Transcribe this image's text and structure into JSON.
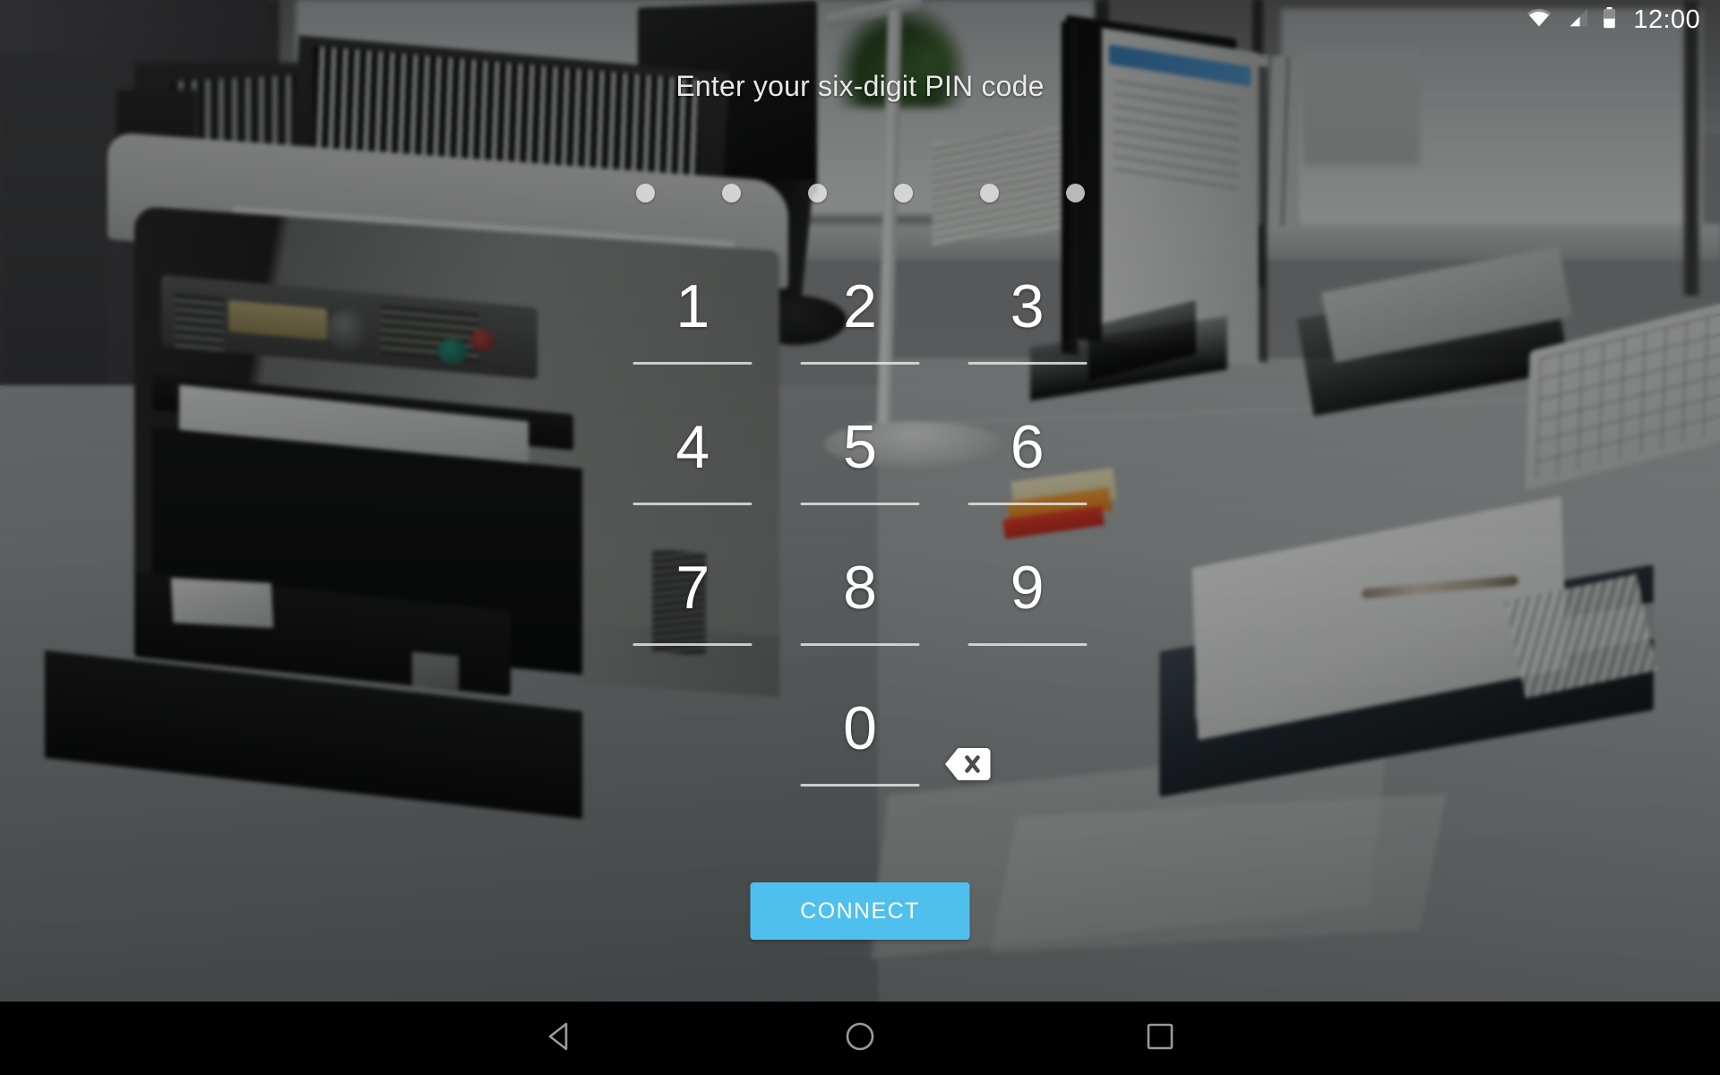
{
  "status_bar": {
    "wifi_icon": "wifi-icon",
    "signal_icon": "cellular-signal-icon",
    "battery_icon": "battery-icon",
    "time": "12:00"
  },
  "pin_screen": {
    "title": "Enter your six-digit PIN code",
    "pin_length": 6,
    "entered_digits": 6,
    "dots": [
      "•",
      "•",
      "•",
      "•",
      "•",
      "•"
    ],
    "keypad": [
      {
        "label": "1",
        "name": "key-1"
      },
      {
        "label": "2",
        "name": "key-2"
      },
      {
        "label": "3",
        "name": "key-3"
      },
      {
        "label": "4",
        "name": "key-4"
      },
      {
        "label": "5",
        "name": "key-5"
      },
      {
        "label": "6",
        "name": "key-6"
      },
      {
        "label": "7",
        "name": "key-7"
      },
      {
        "label": "8",
        "name": "key-8"
      },
      {
        "label": "9",
        "name": "key-9"
      },
      {
        "label": "",
        "name": "key-blank-left"
      },
      {
        "label": "0",
        "name": "key-0"
      },
      {
        "label": "backspace-icon",
        "name": "key-backspace"
      }
    ],
    "connect_label": "CONNECT",
    "accent_color": "#4fc0ee",
    "key_text_color": "#ffffff",
    "title_color": "#e8e8e8"
  },
  "nav_bar": {
    "back_label": "back-icon",
    "home_label": "home-icon",
    "recents_label": "recents-icon",
    "icon_color": "#9a9a9a",
    "background_color": "#000000"
  },
  "background": {
    "description": "office-photo-printer-desk",
    "scrim_color": "rgba(0,0,0,0.42)"
  }
}
